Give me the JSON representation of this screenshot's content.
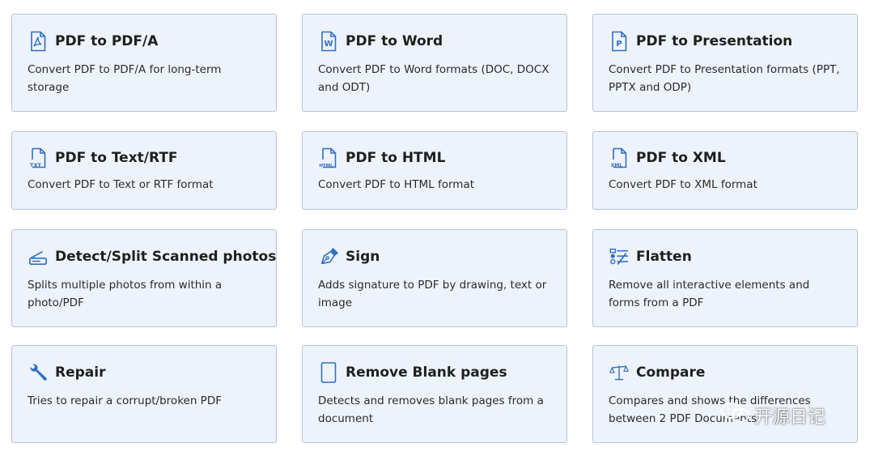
{
  "colors": {
    "card_background": "#eef3fb",
    "card_border": "#b9c3d0",
    "icon_blue": "#2f6fc4",
    "text": "#1f1f1f"
  },
  "cards": [
    {
      "icon": "pdfa-icon",
      "title": "PDF to PDF/A",
      "description": "Convert PDF to PDF/A for long-term storage"
    },
    {
      "icon": "word-icon",
      "title": "PDF to Word",
      "description": "Convert PDF to Word formats (DOC, DOCX and ODT)"
    },
    {
      "icon": "presentation-icon",
      "title": "PDF to Presentation",
      "description": "Convert PDF to Presentation formats (PPT, PPTX and ODP)"
    },
    {
      "icon": "txt-file-icon",
      "title": "PDF to Text/RTF",
      "description": "Convert PDF to Text or RTF format"
    },
    {
      "icon": "html-file-icon",
      "title": "PDF to HTML",
      "description": "Convert PDF to HTML format"
    },
    {
      "icon": "xml-file-icon",
      "title": "PDF to XML",
      "description": "Convert PDF to XML format"
    },
    {
      "icon": "scanner-icon",
      "title": "Detect/Split Scanned photos",
      "description": "Splits multiple photos from within a photo/PDF"
    },
    {
      "icon": "pen-icon",
      "title": "Sign",
      "description": "Adds signature to PDF by drawing, text or image"
    },
    {
      "icon": "flatten-icon",
      "title": "Flatten",
      "description": "Remove all interactive elements and forms from a PDF"
    },
    {
      "icon": "wrench-icon",
      "title": "Repair",
      "description": "Tries to repair a corrupt/broken PDF"
    },
    {
      "icon": "blank-page-icon",
      "title": "Remove Blank pages",
      "description": "Detects and removes blank pages from a document"
    },
    {
      "icon": "scales-icon",
      "title": "Compare",
      "description": "Compares and shows the differences between 2 PDF Documents"
    }
  ],
  "icon_labels": {
    "word_letter": "W",
    "presentation_letter": "P",
    "txt": "TXT",
    "html": "HTML",
    "xml": "XML"
  },
  "watermark": {
    "icon": "wechat-icon",
    "text": "开源日记"
  }
}
